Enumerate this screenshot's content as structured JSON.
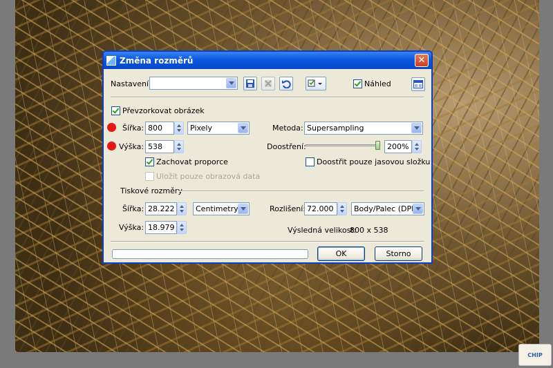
{
  "dialog": {
    "title": "Změna rozměrů",
    "close_glyph": "✕",
    "preset_label": "Nastavení:",
    "preset_value": "",
    "preview_label": "Náhled",
    "preview_checked": true,
    "resample": {
      "label": "Převzorkovat obrázek",
      "checked": true,
      "width_label": "Šířka:",
      "width_value": "800",
      "unit_value": "Pixely",
      "height_label": "Výška:",
      "height_value": "538",
      "keep_ratio_label": "Zachovat proporce",
      "keep_ratio_checked": true,
      "save_image_data_label": "Uložit pouze obrazová data",
      "method_label": "Metoda:",
      "method_value": "Supersampling",
      "sharpen_label": "Doostření:",
      "sharpen_value": "200%",
      "sharpen_level": 1.0,
      "sharpen_luma_label": "Doostřit pouze jasovou složku"
    },
    "print": {
      "section_label": "Tiskové rozměry",
      "width_label": "Šířka:",
      "width_value": "28.222",
      "unit_value": "Centimetry",
      "height_label": "Výška:",
      "height_value": "18.979",
      "resolution_label": "Rozlišení:",
      "resolution_value": "72.000",
      "resolution_unit_value": "Body/Palec (DPI)",
      "result_label": "Výsledná velikost:",
      "result_value": "800 x 538"
    },
    "ok_label": "OK",
    "cancel_label": "Storno"
  },
  "watermark": "CHIP",
  "colors": {
    "title_bar": "#0a58e0",
    "dialog_bg": "#ece9d8",
    "marker": "#e41616"
  }
}
